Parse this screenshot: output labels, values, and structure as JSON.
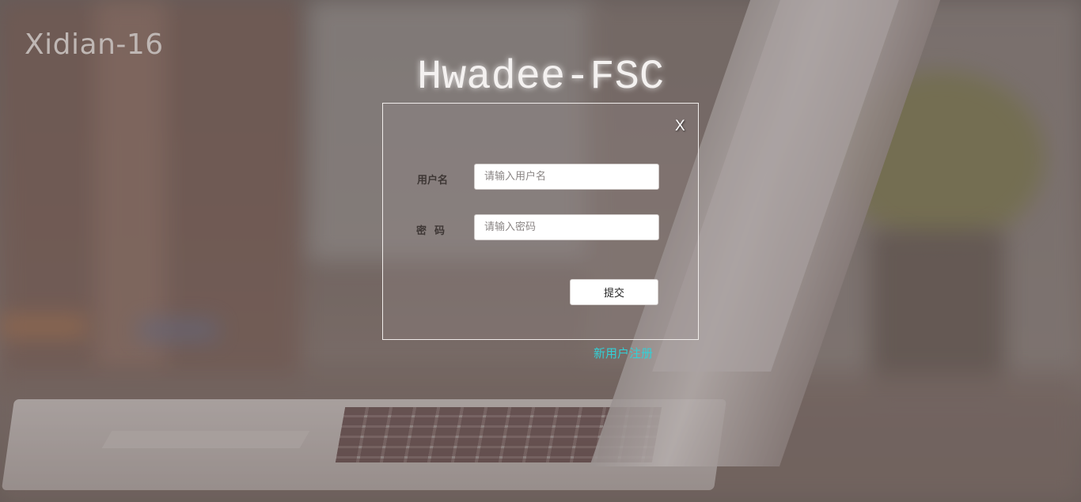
{
  "brand": "Xidian-16",
  "app_title": "Hwadee-FSC",
  "login": {
    "close_label": "X",
    "username_label": "用户名",
    "username_placeholder": "请输入用户名",
    "password_label": "密码",
    "password_placeholder": "请输入密码",
    "submit_label": "提交"
  },
  "register_link": "新用户注册",
  "colors": {
    "title": "#f4f1f0",
    "link": "#33d0d6",
    "box_border": "#f0ecea"
  }
}
